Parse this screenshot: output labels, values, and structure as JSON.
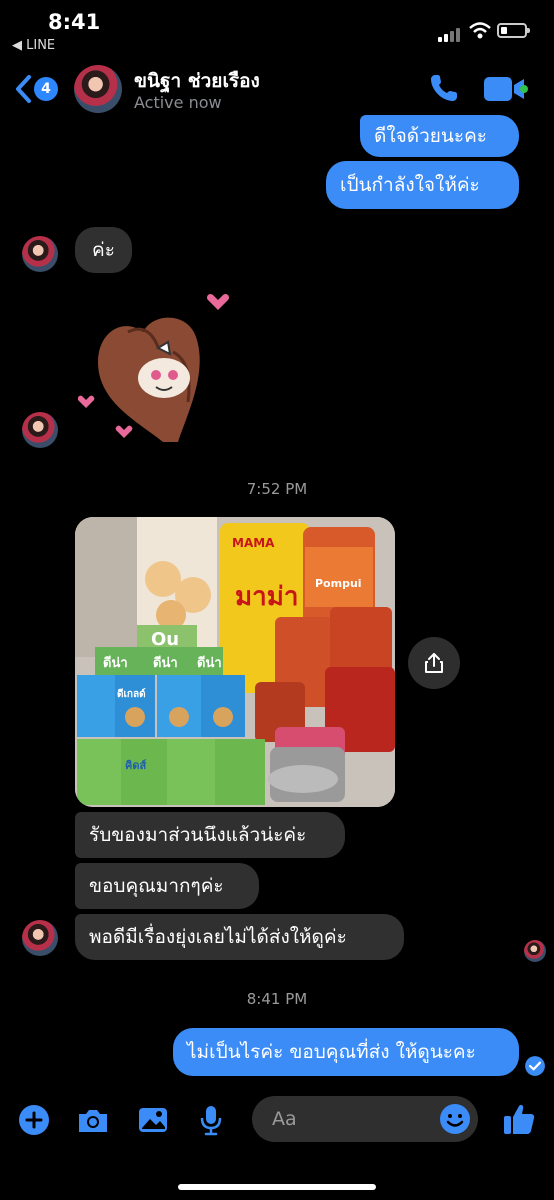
{
  "status_bar": {
    "time": "8:41",
    "back_app": "◀ LINE"
  },
  "header": {
    "unread_count": "4",
    "contact_name": "ขนิฐา ช่วยเรือง",
    "status": "Active now"
  },
  "messages": {
    "out1": "ดีใจด้วยนะคะ",
    "out2": "เป็นกำลังใจให้ค่ะ",
    "in1": "ค่ะ",
    "time1": "7:52 PM",
    "in2": "รับของมาส่วนนึงแล้วน่ะค่ะ",
    "in3": "ขอบคุณมากๆค่ะ",
    "in4": "พอดีมีเรื่องยุ่งเลยไม่ได้ส่งให้ดูค่ะ",
    "time2": "8:41 PM",
    "out3": "ไม่เป็นไรค่ะ ขอบคุณที่ส่ง ให้ดูนะคะ"
  },
  "photo": {
    "brand_noodle": "มาม่า",
    "brand_mama": "MAMA",
    "brand_can": "Pompui",
    "brand_milk1": "ดีน่า",
    "brand_milk2": "ดีน่า",
    "brand_milk3": "ดีน่า",
    "label_box": "ดีเกลด์",
    "label_kids": "คิดส์"
  },
  "composer": {
    "placeholder": "Aa"
  },
  "icons": {
    "accent": "#3b8cf7",
    "bubble_incoming": "#303030"
  }
}
